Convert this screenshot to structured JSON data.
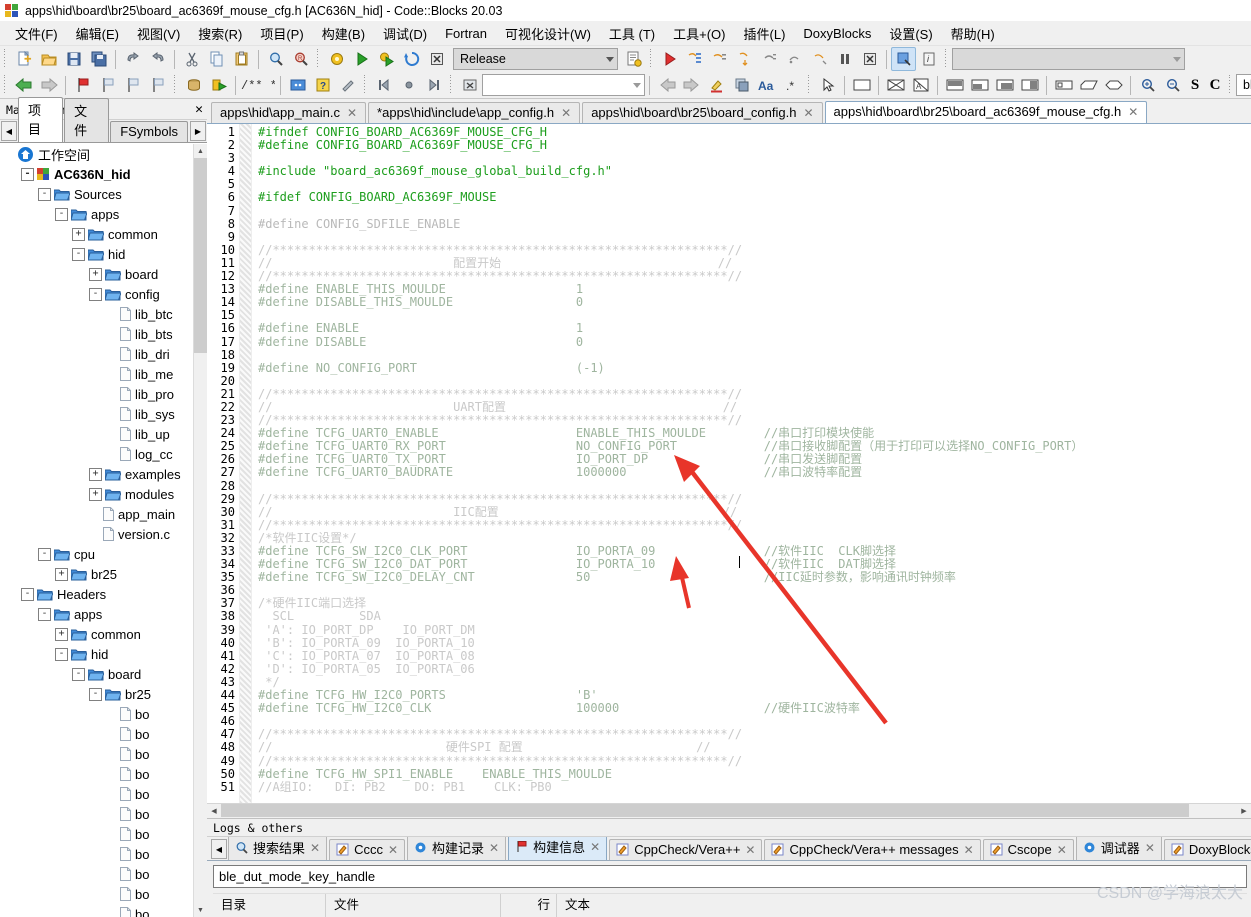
{
  "window": {
    "title": "apps\\hid\\board\\br25\\board_ac6369f_mouse_cfg.h [AC636N_hid] - Code::Blocks 20.03",
    "logo": "codeblocks-logo"
  },
  "menu": [
    {
      "label": "文件(F)"
    },
    {
      "label": "编辑(E)"
    },
    {
      "label": "视图(V)"
    },
    {
      "label": "搜索(R)"
    },
    {
      "label": "项目(P)"
    },
    {
      "label": "构建(B)"
    },
    {
      "label": "调试(D)"
    },
    {
      "label": "Fortran"
    },
    {
      "label": "可视化设计(W)"
    },
    {
      "label": "工具 (T)"
    },
    {
      "label": "工具+(O)"
    },
    {
      "label": "插件(L)"
    },
    {
      "label": "DoxyBlocks"
    },
    {
      "label": "设置(S)"
    },
    {
      "label": "帮助(H)"
    }
  ],
  "toolbar": {
    "build_target": "Release",
    "target_placeholder": "",
    "search_box": "",
    "debug_combo": "",
    "code_combo": "",
    "doxy_box": "ble_dut_m",
    "btn_s": "S",
    "btn_c": "C"
  },
  "management": {
    "title": "Management",
    "close_label": "✕",
    "tabs": [
      {
        "label": "项目",
        "active": true
      },
      {
        "label": "文件",
        "active": false
      },
      {
        "label": "FSymbols",
        "active": false
      }
    ],
    "tree": [
      {
        "label": "工作空间",
        "indent": 0,
        "icon": "workspace-icon",
        "toggle": "",
        "bold": false
      },
      {
        "label": "AC636N_hid",
        "indent": 1,
        "icon": "project-icon",
        "toggle": "-",
        "bold": true
      },
      {
        "label": "Sources",
        "indent": 2,
        "icon": "folder-icon",
        "toggle": "-",
        "bold": false
      },
      {
        "label": "apps",
        "indent": 3,
        "icon": "folder-icon",
        "toggle": "-",
        "bold": false
      },
      {
        "label": "common",
        "indent": 4,
        "icon": "folder-icon",
        "toggle": "+",
        "bold": false
      },
      {
        "label": "hid",
        "indent": 4,
        "icon": "folder-icon",
        "toggle": "-",
        "bold": false
      },
      {
        "label": "board",
        "indent": 5,
        "icon": "folder-icon",
        "toggle": "+",
        "bold": false
      },
      {
        "label": "config",
        "indent": 5,
        "icon": "folder-icon",
        "toggle": "-",
        "bold": false
      },
      {
        "label": "lib_btc",
        "indent": 6,
        "icon": "file-icon",
        "toggle": "",
        "bold": false
      },
      {
        "label": "lib_bts",
        "indent": 6,
        "icon": "file-icon",
        "toggle": "",
        "bold": false
      },
      {
        "label": "lib_dri",
        "indent": 6,
        "icon": "file-icon",
        "toggle": "",
        "bold": false
      },
      {
        "label": "lib_me",
        "indent": 6,
        "icon": "file-icon",
        "toggle": "",
        "bold": false
      },
      {
        "label": "lib_pro",
        "indent": 6,
        "icon": "file-icon",
        "toggle": "",
        "bold": false
      },
      {
        "label": "lib_sys",
        "indent": 6,
        "icon": "file-icon",
        "toggle": "",
        "bold": false
      },
      {
        "label": "lib_up",
        "indent": 6,
        "icon": "file-icon",
        "toggle": "",
        "bold": false
      },
      {
        "label": "log_cc",
        "indent": 6,
        "icon": "file-icon",
        "toggle": "",
        "bold": false
      },
      {
        "label": "examples",
        "indent": 5,
        "icon": "folder-icon",
        "toggle": "+",
        "bold": false
      },
      {
        "label": "modules",
        "indent": 5,
        "icon": "folder-icon",
        "toggle": "+",
        "bold": false
      },
      {
        "label": "app_main",
        "indent": 5,
        "icon": "file-icon",
        "toggle": "",
        "bold": false
      },
      {
        "label": "version.c",
        "indent": 5,
        "icon": "file-icon",
        "toggle": "",
        "bold": false
      },
      {
        "label": "cpu",
        "indent": 2,
        "icon": "folder-icon",
        "toggle": "-",
        "bold": false
      },
      {
        "label": "br25",
        "indent": 3,
        "icon": "folder-icon",
        "toggle": "+",
        "bold": false
      },
      {
        "label": "Headers",
        "indent": 1,
        "icon": "folder-icon",
        "toggle": "-",
        "bold": false
      },
      {
        "label": "apps",
        "indent": 2,
        "icon": "folder-icon",
        "toggle": "-",
        "bold": false
      },
      {
        "label": "common",
        "indent": 3,
        "icon": "folder-icon",
        "toggle": "+",
        "bold": false
      },
      {
        "label": "hid",
        "indent": 3,
        "icon": "folder-icon",
        "toggle": "-",
        "bold": false
      },
      {
        "label": "board",
        "indent": 4,
        "icon": "folder-icon",
        "toggle": "-",
        "bold": false
      },
      {
        "label": "br25",
        "indent": 5,
        "icon": "folder-icon",
        "toggle": "-",
        "bold": false
      },
      {
        "label": "bo",
        "indent": 6,
        "icon": "file-icon",
        "toggle": "",
        "bold": false
      },
      {
        "label": "bo",
        "indent": 6,
        "icon": "file-icon",
        "toggle": "",
        "bold": false
      },
      {
        "label": "bo",
        "indent": 6,
        "icon": "file-icon",
        "toggle": "",
        "bold": false
      },
      {
        "label": "bo",
        "indent": 6,
        "icon": "file-icon",
        "toggle": "",
        "bold": false
      },
      {
        "label": "bo",
        "indent": 6,
        "icon": "file-icon",
        "toggle": "",
        "bold": false
      },
      {
        "label": "bo",
        "indent": 6,
        "icon": "file-icon",
        "toggle": "",
        "bold": false
      },
      {
        "label": "bo",
        "indent": 6,
        "icon": "file-icon",
        "toggle": "",
        "bold": false
      },
      {
        "label": "bo",
        "indent": 6,
        "icon": "file-icon",
        "toggle": "",
        "bold": false
      },
      {
        "label": "bo",
        "indent": 6,
        "icon": "file-icon",
        "toggle": "",
        "bold": false
      },
      {
        "label": "bo",
        "indent": 6,
        "icon": "file-icon",
        "toggle": "",
        "bold": false
      },
      {
        "label": "bo",
        "indent": 6,
        "icon": "file-icon",
        "toggle": "",
        "bold": false
      }
    ]
  },
  "editor": {
    "tabs": [
      {
        "label": "apps\\hid\\app_main.c",
        "active": false
      },
      {
        "label": "*apps\\hid\\include\\app_config.h",
        "active": false
      },
      {
        "label": "apps\\hid\\board\\br25\\board_config.h",
        "active": false
      },
      {
        "label": "apps\\hid\\board\\br25\\board_ac6369f_mouse_cfg.h",
        "active": true
      }
    ],
    "close_label": "✕",
    "first_line": 1,
    "lines": [
      {
        "n": 1,
        "text": "#ifndef CONFIG_BOARD_AC6369F_MOUSE_CFG_H",
        "style": "g"
      },
      {
        "n": 2,
        "text": "#define CONFIG_BOARD_AC6369F_MOUSE_CFG_H",
        "style": "g"
      },
      {
        "n": 3,
        "text": "",
        "style": "g"
      },
      {
        "n": 4,
        "text": "#include \"board_ac6369f_mouse_global_build_cfg.h\"",
        "style": "g"
      },
      {
        "n": 5,
        "text": "",
        "style": "g"
      },
      {
        "n": 6,
        "text": "#ifdef CONFIG_BOARD_AC6369F_MOUSE",
        "style": "g"
      },
      {
        "n": 7,
        "text": "",
        "style": "g"
      },
      {
        "n": 8,
        "text": "#define CONFIG_SDFILE_ENABLE",
        "style": "dim"
      },
      {
        "n": 9,
        "text": "",
        "style": "dim"
      },
      {
        "n": 10,
        "text": "//***************************************************************//",
        "style": "cmt"
      },
      {
        "n": 11,
        "text": "//                         配置开始                              //",
        "style": "cmt"
      },
      {
        "n": 12,
        "text": "//***************************************************************//",
        "style": "cmt"
      },
      {
        "n": 13,
        "text": "#define ENABLE_THIS_MOULDE                  1",
        "style": "dimkw"
      },
      {
        "n": 14,
        "text": "#define DISABLE_THIS_MOULDE                 0",
        "style": "dimkw"
      },
      {
        "n": 15,
        "text": "",
        "style": "dimkw"
      },
      {
        "n": 16,
        "text": "#define ENABLE                              1",
        "style": "dimkw"
      },
      {
        "n": 17,
        "text": "#define DISABLE                             0",
        "style": "dimkw"
      },
      {
        "n": 18,
        "text": "",
        "style": "dimkw"
      },
      {
        "n": 19,
        "text": "#define NO_CONFIG_PORT                      (-1)",
        "style": "dimkw"
      },
      {
        "n": 20,
        "text": "",
        "style": "dimkw"
      },
      {
        "n": 21,
        "text": "//***************************************************************//",
        "style": "cmt"
      },
      {
        "n": 22,
        "text": "//                         UART配置                              //",
        "style": "cmt"
      },
      {
        "n": 23,
        "text": "//***************************************************************//",
        "style": "cmt"
      },
      {
        "n": 24,
        "text": "#define TCFG_UART0_ENABLE                   ENABLE_THIS_MOULDE        //串口打印模块使能",
        "style": "dimkw"
      },
      {
        "n": 25,
        "text": "#define TCFG_UART0_RX_PORT                  NO_CONFIG_PORT            //串口接收脚配置（用于打印可以选择NO_CONFIG_PORT）",
        "style": "dimkw"
      },
      {
        "n": 26,
        "text": "#define TCFG_UART0_TX_PORT                  IO_PORT_DP                //串口发送脚配置",
        "style": "dimkw"
      },
      {
        "n": 27,
        "text": "#define TCFG_UART0_BAUDRATE                 1000000                   //串口波特率配置",
        "style": "dimkw"
      },
      {
        "n": 28,
        "text": "",
        "style": "dimkw"
      },
      {
        "n": 29,
        "text": "//***************************************************************//",
        "style": "cmt"
      },
      {
        "n": 30,
        "text": "//                         IIC配置                               //",
        "style": "cmt"
      },
      {
        "n": 31,
        "text": "//***************************************************************//",
        "style": "cmt"
      },
      {
        "n": 32,
        "text": "/*软件IIC设置*/",
        "style": "cmt"
      },
      {
        "n": 33,
        "text": "#define TCFG_SW_I2C0_CLK_PORT               IO_PORTA_09               //软件IIC  CLK脚选择",
        "style": "dimkw"
      },
      {
        "n": 34,
        "text": "#define TCFG_SW_I2C0_DAT_PORT               IO_PORTA_10               //软件IIC  DAT脚选择",
        "style": "dimkw"
      },
      {
        "n": 35,
        "text": "#define TCFG_SW_I2C0_DELAY_CNT              50                        //IIC延时参数，影响通讯时钟频率",
        "style": "dimkw"
      },
      {
        "n": 36,
        "text": "",
        "style": "dimkw"
      },
      {
        "n": 37,
        "text": "/*硬件IIC端口选择",
        "style": "cmt"
      },
      {
        "n": 38,
        "text": "  SCL         SDA",
        "style": "cmt"
      },
      {
        "n": 39,
        "text": " 'A': IO_PORT_DP    IO_PORT_DM",
        "style": "cmt"
      },
      {
        "n": 40,
        "text": " 'B': IO_PORTA_09  IO_PORTA_10",
        "style": "cmt"
      },
      {
        "n": 41,
        "text": " 'C': IO_PORTA_07  IO_PORTA_08",
        "style": "cmt"
      },
      {
        "n": 42,
        "text": " 'D': IO_PORTA_05  IO_PORTA_06",
        "style": "cmt"
      },
      {
        "n": 43,
        "text": " */",
        "style": "cmt"
      },
      {
        "n": 44,
        "text": "#define TCFG_HW_I2C0_PORTS                  'B'",
        "style": "dimkw"
      },
      {
        "n": 45,
        "text": "#define TCFG_HW_I2C0_CLK                    100000                    //硬件IIC波特率",
        "style": "dimkw"
      },
      {
        "n": 46,
        "text": "",
        "style": "dimkw"
      },
      {
        "n": 47,
        "text": "//***************************************************************//",
        "style": "cmt"
      },
      {
        "n": 48,
        "text": "//                        硬件SPI 配置                        //",
        "style": "cmt"
      },
      {
        "n": 49,
        "text": "//***************************************************************//",
        "style": "cmt"
      },
      {
        "n": 50,
        "text": "#define TCFG_HW_SPI1_ENABLE    ENABLE_THIS_MOULDE",
        "style": "dimkw"
      },
      {
        "n": 51,
        "text": "//A组IO:   DI: PB2    DO: PB1    CLK: PB0",
        "style": "cmt"
      }
    ]
  },
  "logs": {
    "title": "Logs & others",
    "tabs": [
      {
        "label": "搜索结果",
        "icon": "magnifier-icon",
        "active": false
      },
      {
        "label": "Cccc",
        "icon": "pencil-icon",
        "active": false
      },
      {
        "label": "构建记录",
        "icon": "gear-icon",
        "active": false
      },
      {
        "label": "构建信息",
        "icon": "flag-icon",
        "active": true
      },
      {
        "label": "CppCheck/Vera++",
        "icon": "pencil-icon",
        "active": false
      },
      {
        "label": "CppCheck/Vera++ messages",
        "icon": "pencil-icon",
        "active": false
      },
      {
        "label": "Cscope",
        "icon": "pencil-icon",
        "active": false
      },
      {
        "label": "调试器",
        "icon": "gear-icon",
        "active": false
      },
      {
        "label": "DoxyBlocks",
        "icon": "pencil-icon",
        "active": false
      }
    ],
    "close_label": "✕",
    "search_value": "ble_dut_mode_key_handle",
    "grid_headers": [
      "目录",
      "文件",
      "行",
      "文本"
    ]
  },
  "watermark": "CSDN @学海浪太大",
  "colors": {
    "accent": "#1d9e1d",
    "arrow": "#e8352a",
    "active_tab": "#ffffff",
    "panel": "#f0f0f0"
  }
}
